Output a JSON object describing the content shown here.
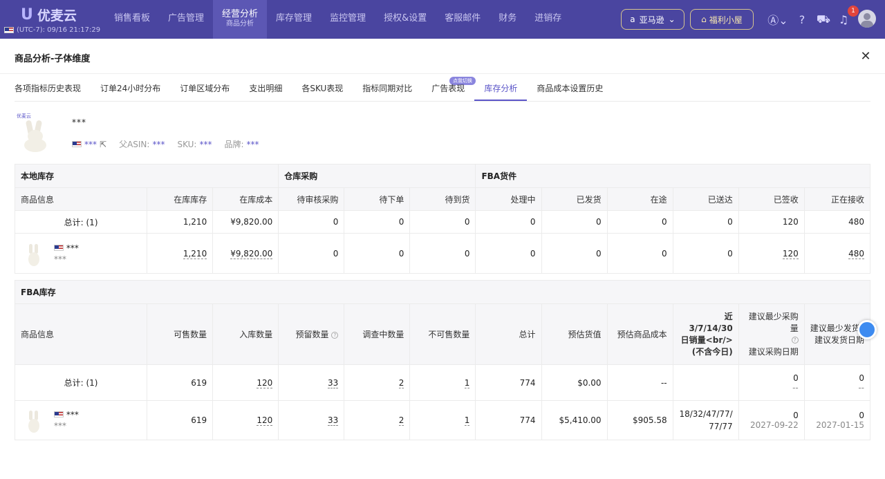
{
  "nav": {
    "logo_text": "优麦云",
    "timezone": "(UTC-7): 09/16 21:17:29",
    "items": [
      {
        "label": "销售看板"
      },
      {
        "label": "广告管理"
      },
      {
        "label": "经营分析",
        "sub": "商品分析"
      },
      {
        "label": "库存管理"
      },
      {
        "label": "监控管理"
      },
      {
        "label": "授权&设置"
      },
      {
        "label": "客服邮件"
      },
      {
        "label": "财务"
      },
      {
        "label": "进销存"
      }
    ],
    "marketplace": "亚马逊",
    "welfare": "福利小屋",
    "notification_count": "1"
  },
  "modal": {
    "title": "商品分析-子体维度",
    "tab_hint": "点我切换",
    "tabs": [
      "各项指标历史表现",
      "订单24小时分布",
      "订单区域分布",
      "支出明细",
      "各SKU表现",
      "指标同期对比",
      "广告表现",
      "库存分析",
      "商品成本设置历史"
    ]
  },
  "product": {
    "name": "***",
    "asin": "***",
    "parent_asin_label": "父ASIN:",
    "parent_asin": "***",
    "sku_label": "SKU:",
    "sku": "***",
    "brand_label": "品牌:",
    "brand": "***",
    "thumb_logo": "优麦云"
  },
  "table1": {
    "groups": [
      "本地库存",
      "仓库采购",
      "FBA货件"
    ],
    "headers": [
      "商品信息",
      "在库库存",
      "在库成本",
      "待审核采购",
      "待下单",
      "待到货",
      "处理中",
      "已发货",
      "在途",
      "已送达",
      "已签收",
      "正在接收"
    ],
    "total_label": "总计: (1)",
    "total_row": [
      "1,210",
      "¥9,820.00",
      "0",
      "0",
      "0",
      "0",
      "0",
      "0",
      "0",
      "120",
      "480"
    ],
    "item_name": "***",
    "item_sub": "***",
    "item_row": [
      "1,210",
      "¥9,820.00",
      "0",
      "0",
      "0",
      "0",
      "0",
      "0",
      "0",
      "120",
      "480"
    ]
  },
  "table2": {
    "group": "FBA库存",
    "headers": [
      "商品信息",
      "可售数量",
      "入库数量",
      "预留数量",
      "调查中数量",
      "不可售数量",
      "总计",
      "预估货值",
      "预估商品成本",
      "近 3/7/14/30 日销量<br/> (不含今日)",
      "建议最少采购量",
      "建议最少发货FBA"
    ],
    "header_sub": {
      "purchase_date": "建议采购日期",
      "ship_date": "建议发货日期"
    },
    "total_label": "总计: (1)",
    "total_row": [
      "619",
      "120",
      "33",
      "2",
      "1",
      "774",
      "$0.00",
      "--",
      ""
    ],
    "total_purchase": "0",
    "total_purchase_date": "--",
    "total_ship": "0",
    "total_ship_date": "--",
    "item_name": "***",
    "item_sub": "***",
    "item_row": [
      "619",
      "120",
      "33",
      "2",
      "1",
      "774",
      "$5,410.00",
      "$905.58",
      "18/32/47/77/ 77/77"
    ],
    "item_purchase": "0",
    "item_purchase_date": "2027-09-22",
    "item_ship": "0",
    "item_ship_date": "2027-01-15"
  }
}
